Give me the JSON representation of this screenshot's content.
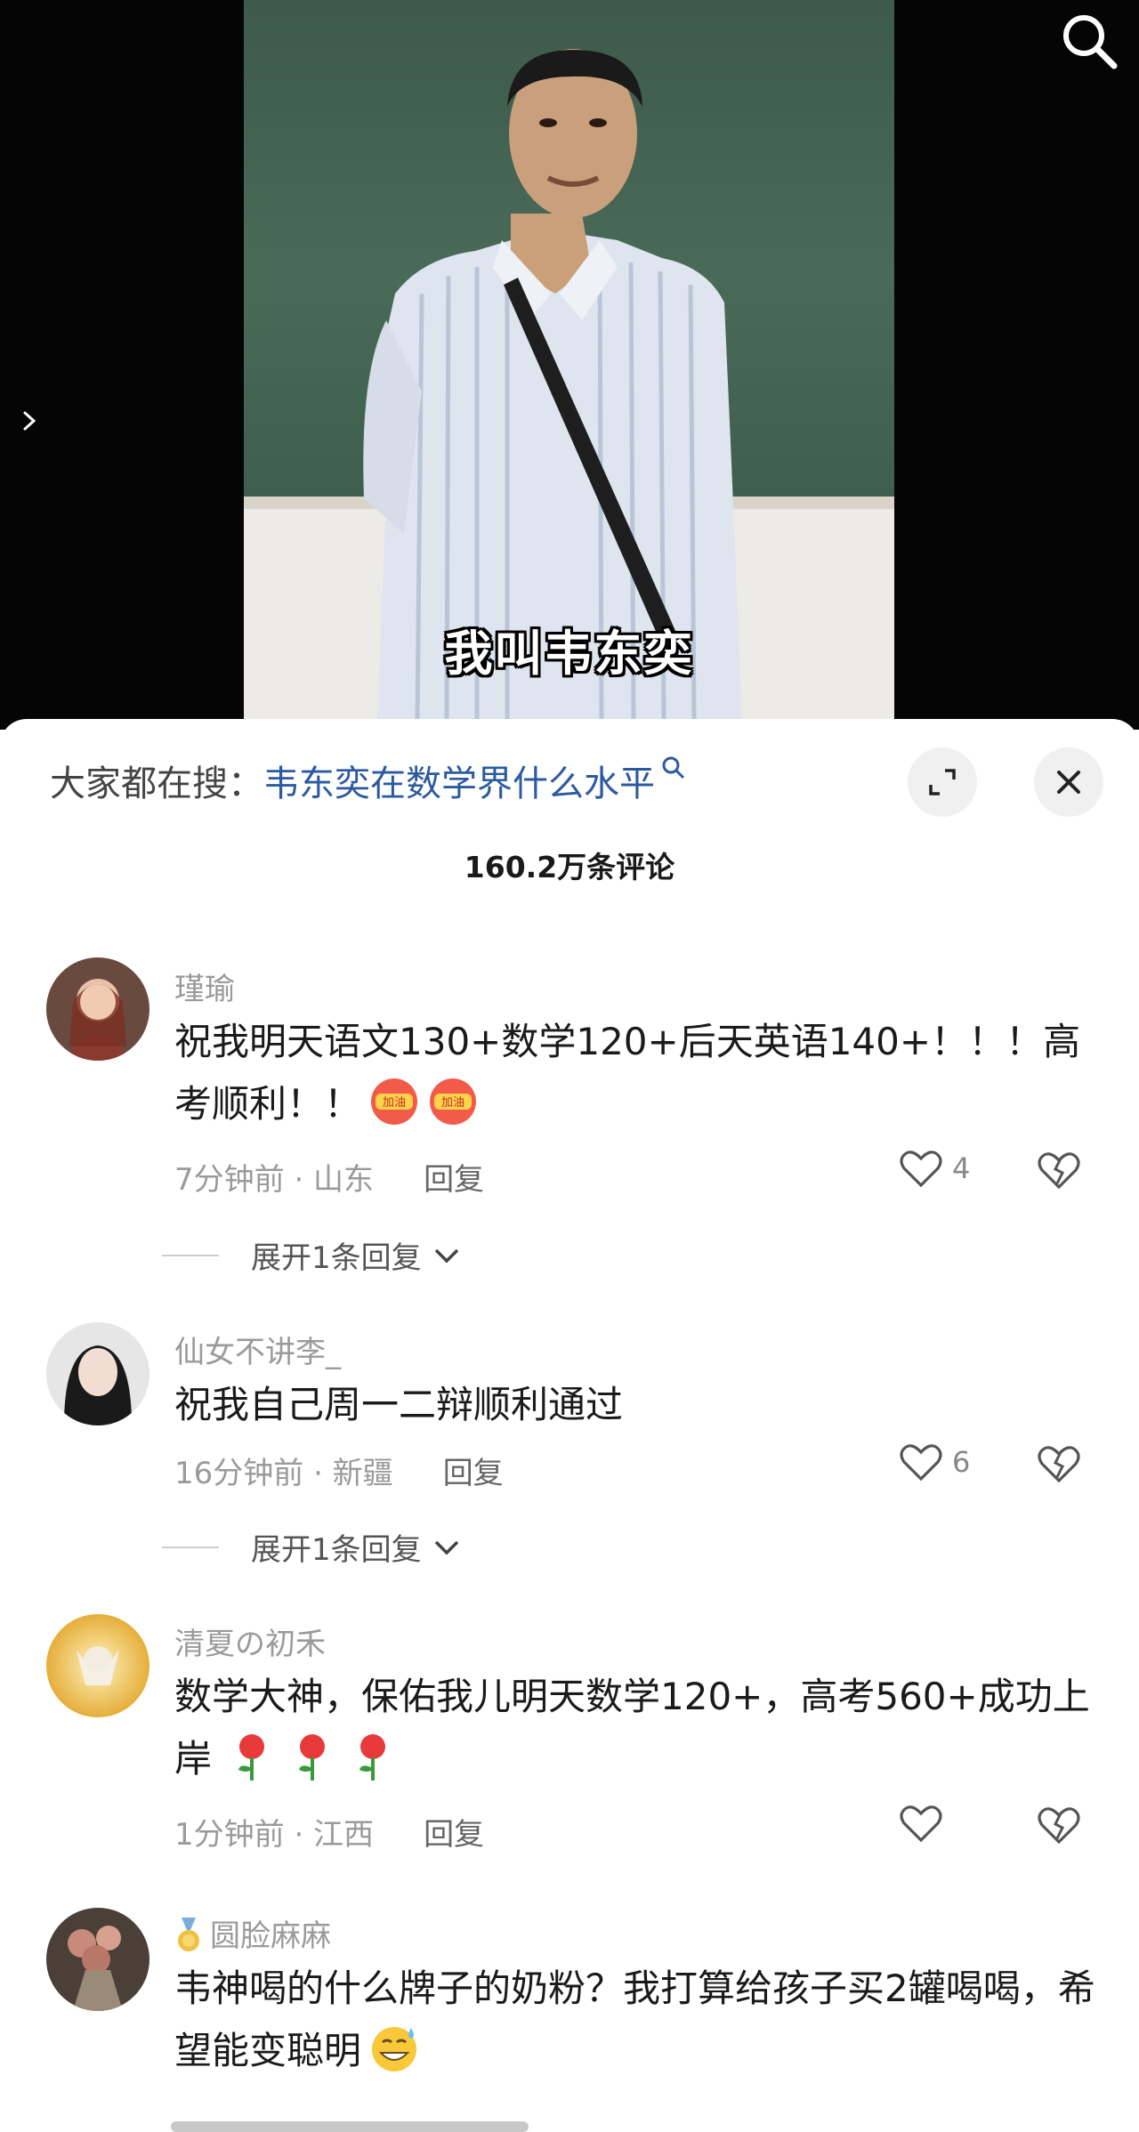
{
  "video": {
    "subtitle": "我叫韦东奕",
    "search_icon": "search-icon",
    "arrow_icon": "chevron-right-icon"
  },
  "sheet": {
    "suggest_prefix": "大家都在搜：",
    "suggest_query": "韦东奕在数学界什么水平",
    "comment_count": "160.2万条评论"
  },
  "comments": [
    {
      "name": "瑾瑜",
      "text": "祝我明天语文130+数学120+后天英语140+！！！高考顺利！！",
      "meta": "7分钟前 · 山东",
      "reply": "回复",
      "likes": "4",
      "expand": "展开1条回复",
      "emoji": "加油"
    },
    {
      "name": "仙女不讲李_",
      "text": "祝我自己周一二辩顺利通过",
      "meta": "16分钟前 · 新疆",
      "reply": "回复",
      "likes": "6",
      "expand": "展开1条回复"
    },
    {
      "name": "清夏の初禾",
      "text": "数学大神，保佑我儿明天数学120+，高考560+成功上岸",
      "meta": "1分钟前 · 江西",
      "reply": "回复",
      "likes": ""
    },
    {
      "name": "圆脸麻麻",
      "text": "韦神喝的什么牌子的奶粉？我打算给孩子买2罐喝喝，希望能变聪明"
    }
  ],
  "colors": {
    "accent_query": "#2c5aa0",
    "muted": "#9a9a9a"
  }
}
